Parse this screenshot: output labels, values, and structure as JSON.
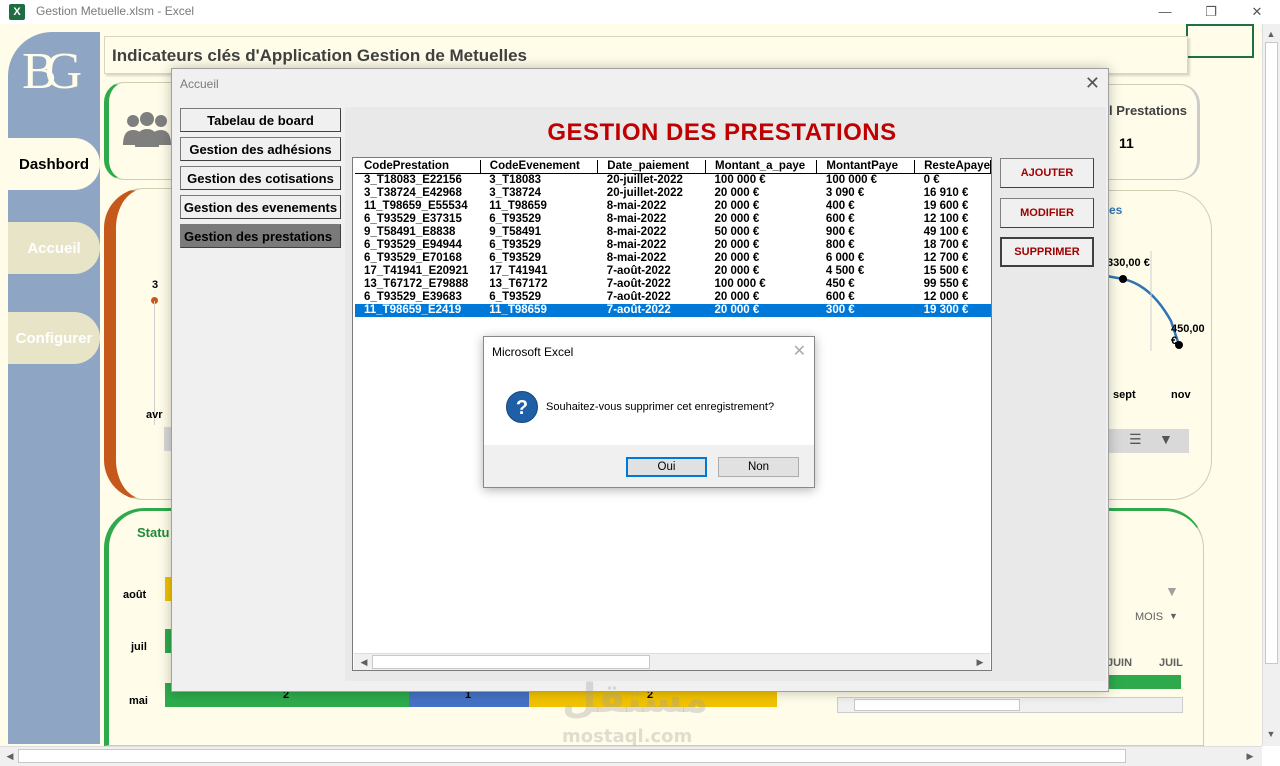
{
  "window": {
    "app_title": "Gestion Metuelle.xlsm - Excel",
    "icon_letter": "X"
  },
  "dashboard": {
    "title": "Indicateurs clés d'Application Gestion de Metuelles",
    "logo_text": "BG",
    "sidebar": [
      "Dashbord",
      "Accueil",
      "Configurer"
    ],
    "kpi_prestations_label": "l Prestations",
    "kpi_prestations_value": "11",
    "chart_left_value": "3",
    "chart_left_month": "avr",
    "chart_right_labels": [
      "330,00 €",
      "450,00 €"
    ],
    "chart_right_months": [
      "sept",
      "nov"
    ],
    "chart_right_title_fragment": "es",
    "status_label": "Statu",
    "status_months": [
      "août",
      "juil",
      "mai"
    ],
    "status_bar_values": [
      "2",
      "1",
      "2"
    ],
    "slicer_label": "MOIS",
    "slicer_months": [
      "JUIN",
      "JUIL"
    ],
    "colors": {
      "accent_green": "#2eaa4c",
      "accent_orange": "#c5591b",
      "sidebar": "#8ea6c4",
      "cream": "#fffde9"
    }
  },
  "form": {
    "title": "Accueil",
    "menu": [
      {
        "label": "Tabelau de board",
        "active": false
      },
      {
        "label": "Gestion des adhésions",
        "active": false
      },
      {
        "label": "Gestion des cotisations",
        "active": false
      },
      {
        "label": "Gestion des evenements",
        "active": false
      },
      {
        "label": "Gestion des prestations",
        "active": true
      }
    ],
    "heading": "GESTION DES PRESTATIONS",
    "actions": [
      "AJOUTER",
      "MODIFIER",
      "SUPPRIMER"
    ],
    "table": {
      "columns": [
        "CodePrestation",
        "CodeEvenement",
        "Date_paiement",
        "Montant_a_paye",
        "MontantPaye",
        "ResteApaye"
      ],
      "rows": [
        [
          "3_T18083_E22156",
          "3_T18083",
          "20-juillet-2022",
          "100 000 €",
          "100 000 €",
          "0 €"
        ],
        [
          "3_T38724_E42968",
          "3_T38724",
          "20-juillet-2022",
          "20 000 €",
          "3 090 €",
          "16 910 €"
        ],
        [
          "11_T98659_E55534",
          "11_T98659",
          "8-mai-2022",
          "20 000 €",
          "400 €",
          "19 600 €"
        ],
        [
          "6_T93529_E37315",
          "6_T93529",
          "8-mai-2022",
          "20 000 €",
          "600 €",
          "12 100 €"
        ],
        [
          "9_T58491_E8838",
          "9_T58491",
          "8-mai-2022",
          "50 000 €",
          "900 €",
          "49 100 €"
        ],
        [
          "6_T93529_E94944",
          "6_T93529",
          "8-mai-2022",
          "20 000 €",
          "800 €",
          "18 700 €"
        ],
        [
          "6_T93529_E70168",
          "6_T93529",
          "8-mai-2022",
          "20 000 €",
          "6 000 €",
          "12 700 €"
        ],
        [
          "17_T41941_E20921",
          "17_T41941",
          "7-août-2022",
          "20 000 €",
          "4 500 €",
          "15 500 €"
        ],
        [
          "13_T67172_E79888",
          "13_T67172",
          "7-août-2022",
          "100 000 €",
          "450 €",
          "99 550 €"
        ],
        [
          "6_T93529_E39683",
          "6_T93529",
          "7-août-2022",
          "20 000 €",
          "600 €",
          "12 000 €"
        ],
        [
          "11_T98659_E2419",
          "11_T98659",
          "7-août-2022",
          "20 000 €",
          "300 €",
          "19 300 €"
        ]
      ],
      "selected_row": 10
    }
  },
  "msgbox": {
    "title": "Microsoft Excel",
    "message": "Souhaitez-vous supprimer cet enregistrement?",
    "icon": "question-icon",
    "buttons": {
      "yes": "Oui",
      "no": "Non"
    }
  },
  "watermark": {
    "arabic": "مستقل",
    "latin": "mostaql.com"
  }
}
